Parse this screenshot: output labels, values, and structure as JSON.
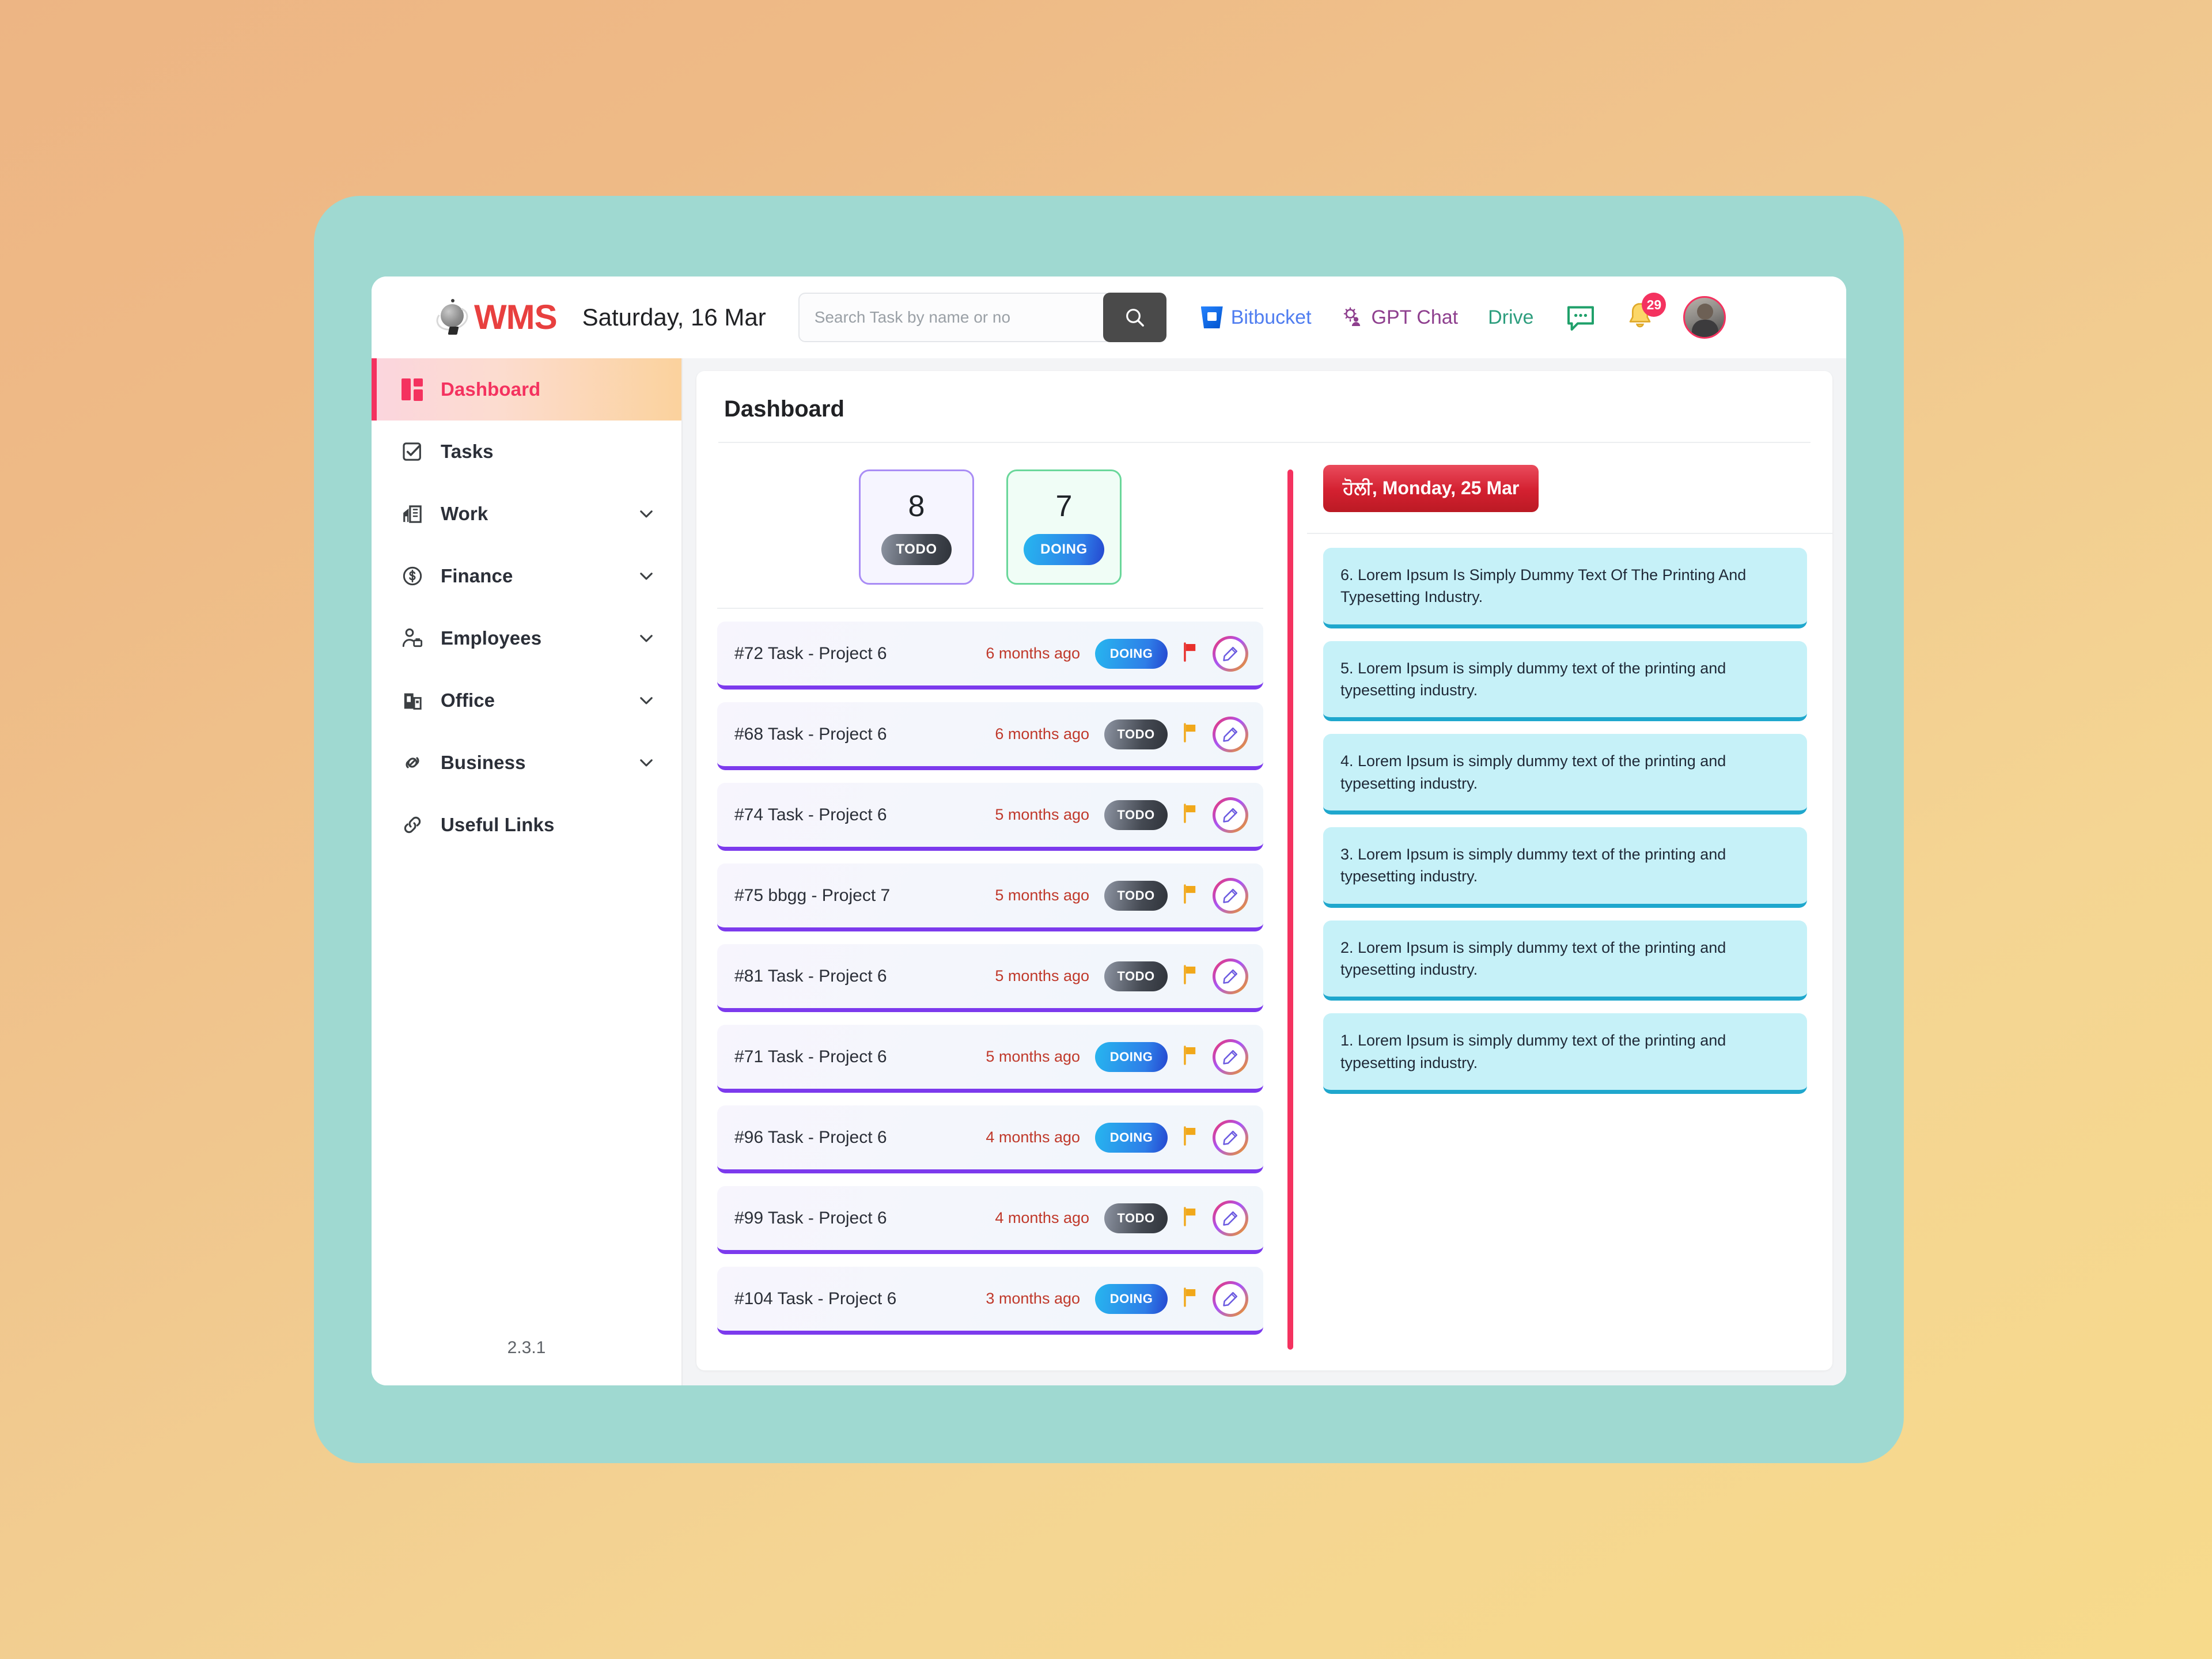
{
  "header": {
    "brand_name": "WMS",
    "date": "Saturday, 16 Mar",
    "search_placeholder": "Search Task by name or no",
    "search_value": "",
    "links": [
      {
        "label": "Bitbucket",
        "icon": "bitbucket-icon"
      },
      {
        "label": "GPT Chat",
        "icon": "gpt-chat-icon"
      },
      {
        "label": "Drive",
        "icon": "drive-link"
      }
    ],
    "notification_count": "29"
  },
  "sidebar": {
    "version": "2.3.1",
    "items": [
      {
        "label": "Dashboard",
        "icon": "dashboard-icon",
        "active": true,
        "expandable": false
      },
      {
        "label": "Tasks",
        "icon": "tasks-icon",
        "active": false,
        "expandable": false
      },
      {
        "label": "Work",
        "icon": "work-icon",
        "active": false,
        "expandable": true
      },
      {
        "label": "Finance",
        "icon": "finance-icon",
        "active": false,
        "expandable": true
      },
      {
        "label": "Employees",
        "icon": "employees-icon",
        "active": false,
        "expandable": true
      },
      {
        "label": "Office",
        "icon": "office-icon",
        "active": false,
        "expandable": true
      },
      {
        "label": "Business",
        "icon": "business-icon",
        "active": false,
        "expandable": true
      },
      {
        "label": "Useful Links",
        "icon": "useful-links-icon",
        "active": false,
        "expandable": false
      }
    ]
  },
  "main": {
    "page_title": "Dashboard",
    "stats": [
      {
        "count": "8",
        "label": "TODO",
        "theme": "todo"
      },
      {
        "count": "7",
        "label": "DOING",
        "theme": "doing"
      }
    ],
    "tasks": [
      {
        "name": "#72 Task - Project 6",
        "age": "6 months ago",
        "status": "DOING",
        "flag": "red"
      },
      {
        "name": "#68 Task - Project 6",
        "age": "6 months ago",
        "status": "TODO",
        "flag": "yellow"
      },
      {
        "name": "#74 Task - Project 6",
        "age": "5 months ago",
        "status": "TODO",
        "flag": "yellow"
      },
      {
        "name": "#75 bbgg - Project 7",
        "age": "5 months ago",
        "status": "TODO",
        "flag": "yellow"
      },
      {
        "name": "#81 Task - Project 6",
        "age": "5 months ago",
        "status": "TODO",
        "flag": "yellow"
      },
      {
        "name": "#71 Task - Project 6",
        "age": "5 months ago",
        "status": "DOING",
        "flag": "yellow"
      },
      {
        "name": "#96 Task - Project 6",
        "age": "4 months ago",
        "status": "DOING",
        "flag": "yellow"
      },
      {
        "name": "#99 Task - Project 6",
        "age": "4 months ago",
        "status": "TODO",
        "flag": "yellow"
      },
      {
        "name": "#104 Task - Project 6",
        "age": "3 months ago",
        "status": "DOING",
        "flag": "yellow"
      }
    ],
    "holiday_chip": "ਹੋਲੀ, Monday, 25 Mar",
    "notices": [
      {
        "text": "6. Lorem Ipsum Is Simply Dummy Text Of The Printing And Typesetting Industry."
      },
      {
        "text": "5. Lorem Ipsum is simply dummy text of the printing and typesetting industry."
      },
      {
        "text": "4. Lorem Ipsum is simply dummy text of the printing and typesetting industry."
      },
      {
        "text": "3. Lorem Ipsum is simply dummy text of the printing and typesetting industry."
      },
      {
        "text": "2. Lorem Ipsum is simply dummy text of the printing and typesetting industry."
      },
      {
        "text": "1. Lorem Ipsum is simply dummy text of the printing and typesetting industry."
      }
    ]
  },
  "colors": {
    "accent_pink": "#f4325f",
    "brand_red": "#e8403f",
    "frame_teal": "#9fd9d1",
    "task_underline": "#7c3aed",
    "notice_bg": "#c6f1f8",
    "notice_underline": "#1fa7cd"
  }
}
